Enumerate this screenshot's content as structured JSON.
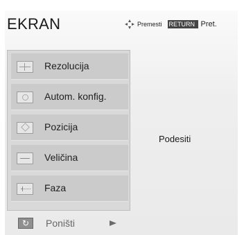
{
  "screen": {
    "title": "EKRAN"
  },
  "hints": {
    "move_label": "Premesti",
    "return_key": "RETURN",
    "return_label": "Pret."
  },
  "menu": {
    "items": [
      {
        "label": "Rezolucija",
        "icon": "crosshair-icon"
      },
      {
        "label": "Autom. konfig.",
        "icon": "circle-icon"
      },
      {
        "label": "Pozicija",
        "icon": "diamond-icon"
      },
      {
        "label": "Veličina",
        "icon": "minus-icon"
      },
      {
        "label": "Faza",
        "icon": "phase-icon"
      }
    ],
    "reset": {
      "label": "Poništi",
      "icon": "reset-icon",
      "arrow_icon": "arrow-right-icon"
    }
  },
  "detail": {
    "value": "Podesiti"
  }
}
